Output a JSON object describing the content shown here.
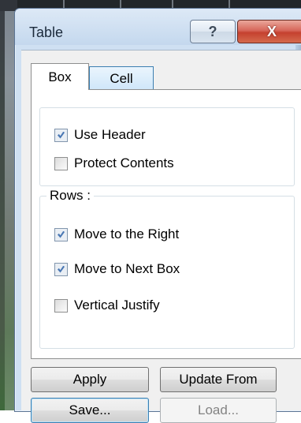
{
  "window": {
    "title": "Table"
  },
  "titlebar": {
    "help_symbol": "?",
    "close_symbol": "X"
  },
  "tabs": [
    {
      "label": "Box",
      "selected": true
    },
    {
      "label": "Cell",
      "selected": false
    }
  ],
  "options": {
    "use_header": {
      "label": "Use Header",
      "checked": true
    },
    "protect_contents": {
      "label": "Protect Contents",
      "checked": false
    }
  },
  "rows": {
    "legend": "Rows :",
    "move_right": {
      "label": "Move to the Right",
      "checked": true
    },
    "move_next_box": {
      "label": "Move to Next Box",
      "checked": true
    },
    "vertical_justify": {
      "label": "Vertical Justify",
      "checked": false
    }
  },
  "buttons": {
    "apply": "Apply",
    "update_from": "Update From",
    "save": "Save...",
    "load": "Load..."
  },
  "colors": {
    "window_frame": "#cfe0f2",
    "close_button": "#c5412f",
    "checkmark": "#4a78b4"
  }
}
